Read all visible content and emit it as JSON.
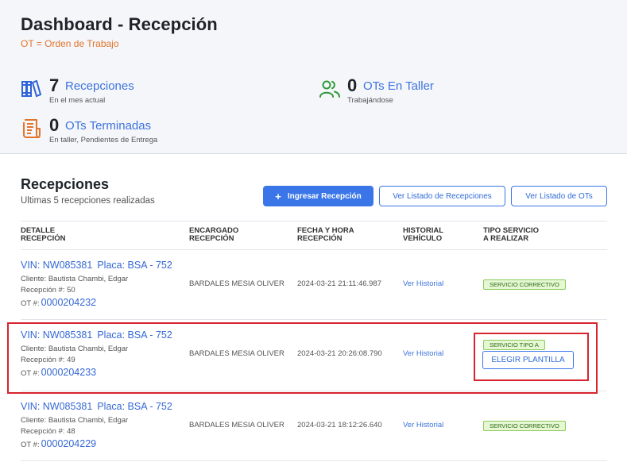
{
  "header": {
    "title": "Dashboard - Recepción",
    "subtitle": "OT = Orden de Trabajo"
  },
  "stats": [
    {
      "icon": "books-icon",
      "count": "7",
      "label": "Recepciones",
      "desc": "En el mes actual",
      "color": "#3d73dd"
    },
    {
      "icon": "users-icon",
      "count": "0",
      "label": "OTs En Taller",
      "desc": "Trabajándose",
      "color": "#2d9a3a"
    },
    {
      "icon": "receipt-icon",
      "count": "0",
      "label": "OTs Terminadas",
      "desc": "En taller, Pendientes de Entrega",
      "color": "#e3742a"
    }
  ],
  "section": {
    "title": "Recepciones",
    "subtitle": "Ultimas 5 recepciones realizadas"
  },
  "buttons": {
    "ingresar": "Ingresar Recepción",
    "listado_recepciones": "Ver Listado de Recepciones",
    "listado_ots": "Ver Listado de OTs"
  },
  "table": {
    "headers": [
      {
        "l1": "DETALLE",
        "l2": "RECEPCIÓN"
      },
      {
        "l1": "ENCARGADO",
        "l2": "RECEPCIÓN"
      },
      {
        "l1": "FECHA Y HORA",
        "l2": "RECEPCIÓN"
      },
      {
        "l1": "HISTORIAL",
        "l2": "VEHÍCULO"
      },
      {
        "l1": "TIPO SERVICIO",
        "l2": "A REALIZAR"
      }
    ],
    "rows": [
      {
        "vin": "VIN: NW085381",
        "placa": "Placa: BSA - 752",
        "cliente": "Cliente: Bautista Chambi, Edgar",
        "recepcion": "Recepción #: 50",
        "ot_label": "OT #:",
        "ot": "0000204232",
        "encargado": "BARDALES MESIA OLIVER",
        "fecha": "2024-03-21 21:11:46.987",
        "historial": "Ver Historial",
        "servicio": "SERVICIO CORRECTIVO"
      },
      {
        "vin": "VIN: NW085381",
        "placa": "Placa: BSA - 752",
        "cliente": "Cliente: Bautista Chambi, Edgar",
        "recepcion": "Recepción #: 49",
        "ot_label": "OT #:",
        "ot": "0000204233",
        "encargado": "BARDALES MESIA OLIVER",
        "fecha": "2024-03-21 20:26:08.790",
        "historial": "Ver Historial",
        "servicio": "SERVICIO TIPO A",
        "action": "ELEGIR PLANTILLA"
      },
      {
        "vin": "VIN: NW085381",
        "placa": "Placa: BSA - 752",
        "cliente": "Cliente: Bautista Chambi, Edgar",
        "recepcion": "Recepción #: 48",
        "ot_label": "OT #:",
        "ot": "0000204229",
        "encargado": "BARDALES MESIA OLIVER",
        "fecha": "2024-03-21 18:12:26.640",
        "historial": "Ver Historial",
        "servicio": "SERVICIO CORRECTIVO"
      }
    ]
  }
}
